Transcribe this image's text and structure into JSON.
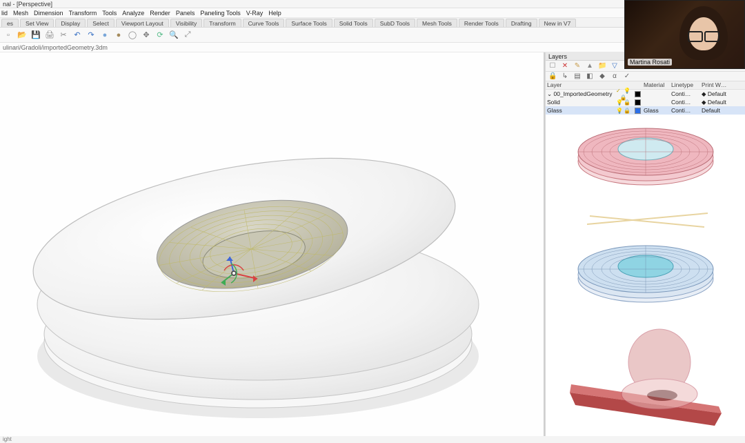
{
  "window": {
    "title": "nal - [Perspective]"
  },
  "menu": {
    "items": [
      "lid",
      "Mesh",
      "Dimension",
      "Transform",
      "Tools",
      "Analyze",
      "Render",
      "Panels",
      "Paneling Tools",
      "V-Ray",
      "Help"
    ]
  },
  "ribbon": {
    "tabs": [
      "es",
      "Set View",
      "Display",
      "Select",
      "Viewport Layout",
      "Visibility",
      "Transform",
      "Curve Tools",
      "Surface Tools",
      "Solid Tools",
      "SubD Tools",
      "Mesh Tools",
      "Render Tools",
      "Drafting",
      "New in V7"
    ]
  },
  "toolbar": {
    "icons": [
      {
        "name": "new-icon",
        "glyph": "▫",
        "color": "#888"
      },
      {
        "name": "open-icon",
        "glyph": "📂",
        "color": "#c79b4a"
      },
      {
        "name": "save-icon",
        "glyph": "💾",
        "color": "#5a7fb0"
      },
      {
        "name": "print-icon",
        "glyph": "🖨",
        "color": "#888"
      },
      {
        "name": "cut-icon",
        "glyph": "✂",
        "color": "#888"
      },
      {
        "name": "undo-icon",
        "glyph": "↶",
        "color": "#3a72c4"
      },
      {
        "name": "redo-icon",
        "glyph": "↷",
        "color": "#3a72c4"
      },
      {
        "name": "sphere-icon",
        "glyph": "●",
        "color": "#7aa7d9"
      },
      {
        "name": "sphere2-icon",
        "glyph": "●",
        "color": "#a58b5c"
      },
      {
        "name": "torus-icon",
        "glyph": "◯",
        "color": "#888"
      },
      {
        "name": "pan-icon",
        "glyph": "✥",
        "color": "#777"
      },
      {
        "name": "rot-icon",
        "glyph": "⟳",
        "color": "#5b8"
      },
      {
        "name": "zoom-icon",
        "glyph": "🔍",
        "color": "#888"
      },
      {
        "name": "zoomext-icon",
        "glyph": "⤢",
        "color": "#888"
      }
    ]
  },
  "address": {
    "path": "ulinari/Gradoli/importedGeometry.3dm"
  },
  "layers_panel": {
    "title": "Layers",
    "toolbar_icons": [
      {
        "name": "new-layer-icon",
        "glyph": "☐",
        "color": "#888"
      },
      {
        "name": "delete-layer-icon",
        "glyph": "✕",
        "color": "#c33"
      },
      {
        "name": "edit-layer-icon",
        "glyph": "✎",
        "color": "#c79b4a"
      },
      {
        "name": "up-icon",
        "glyph": "▲",
        "color": "#888"
      },
      {
        "name": "folder-icon",
        "glyph": "📁",
        "color": "#c79b4a"
      },
      {
        "name": "filter-icon",
        "glyph": "▽",
        "color": "#3a72c4"
      },
      {
        "name": "options-icon",
        "glyph": "⚙",
        "color": "#888"
      }
    ],
    "toolbar2_icons": [
      {
        "name": "lock-icon",
        "glyph": "🔒"
      },
      {
        "name": "new-sub-icon",
        "glyph": "↳"
      },
      {
        "name": "props-icon",
        "glyph": "▤"
      },
      {
        "name": "color-icon",
        "glyph": "◧"
      },
      {
        "name": "mat-icon",
        "glyph": "◆"
      },
      {
        "name": "alpha-icon",
        "glyph": "α"
      },
      {
        "name": "curr-icon",
        "glyph": "✓"
      }
    ],
    "headers": {
      "layer": "Layer",
      "material": "Material",
      "linetype": "Linetype",
      "printw": "Print W…"
    },
    "rows": [
      {
        "expand": "⌄",
        "name": "00_ImportedGeometry",
        "color": "#000000",
        "current": true,
        "material": "",
        "linetype": "Conti…",
        "printw": "◆ Default",
        "selected": false
      },
      {
        "expand": " ",
        "name": "Solid",
        "color": "#000000",
        "current": false,
        "material": "",
        "linetype": "Conti…",
        "printw": "◆ Default",
        "selected": false
      },
      {
        "expand": " ",
        "name": "Glass",
        "color": "#2b6fe8",
        "current": false,
        "material": "Glass",
        "linetype": "Conti…",
        "printw": "Default",
        "selected": true
      }
    ]
  },
  "status": {
    "left": "ight"
  },
  "webcam": {
    "name": "Martina Rosati"
  }
}
